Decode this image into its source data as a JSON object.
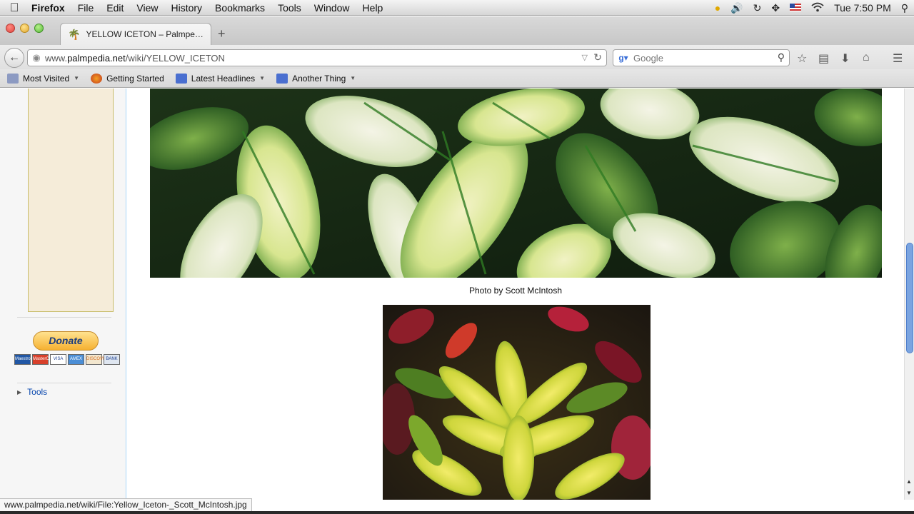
{
  "menubar": {
    "app": "Firefox",
    "items": [
      "File",
      "Edit",
      "View",
      "History",
      "Bookmarks",
      "Tools",
      "Window",
      "Help"
    ],
    "clock": "Tue 7:50 PM"
  },
  "tab": {
    "title": "YELLOW ICETON – Palmpe…"
  },
  "navbar": {
    "url_prefix": "www.",
    "url_domain": "palmpedia.net",
    "url_path": "/wiki/YELLOW_ICETON",
    "search_placeholder": "Google"
  },
  "bookmarks": [
    {
      "label": "Most Visited",
      "icon": "folder-icon",
      "has_menu": true
    },
    {
      "label": "Getting Started",
      "icon": "firefox-icon",
      "has_menu": false
    },
    {
      "label": "Latest Headlines",
      "icon": "rss-icon",
      "has_menu": true
    },
    {
      "label": "Another Thing",
      "icon": "rss-icon",
      "has_menu": true
    }
  ],
  "sidebar": {
    "donate_label": "Donate",
    "cards": [
      "Maestro",
      "MasterCard",
      "VISA",
      "AMEX",
      "DISCOVER",
      "BANK"
    ],
    "tools_label": "Tools"
  },
  "content": {
    "caption": "Photo by Scott McIntosh"
  },
  "status": {
    "text": "www.palmpedia.net/wiki/File:Yellow_Iceton-_Scott_McIntosh.jpg"
  },
  "colors": {
    "link": "#0645ad",
    "content_border": "#a7d7f9",
    "ad_box": "#f5ecd9",
    "scroll_thumb": "#7aa4e0"
  }
}
